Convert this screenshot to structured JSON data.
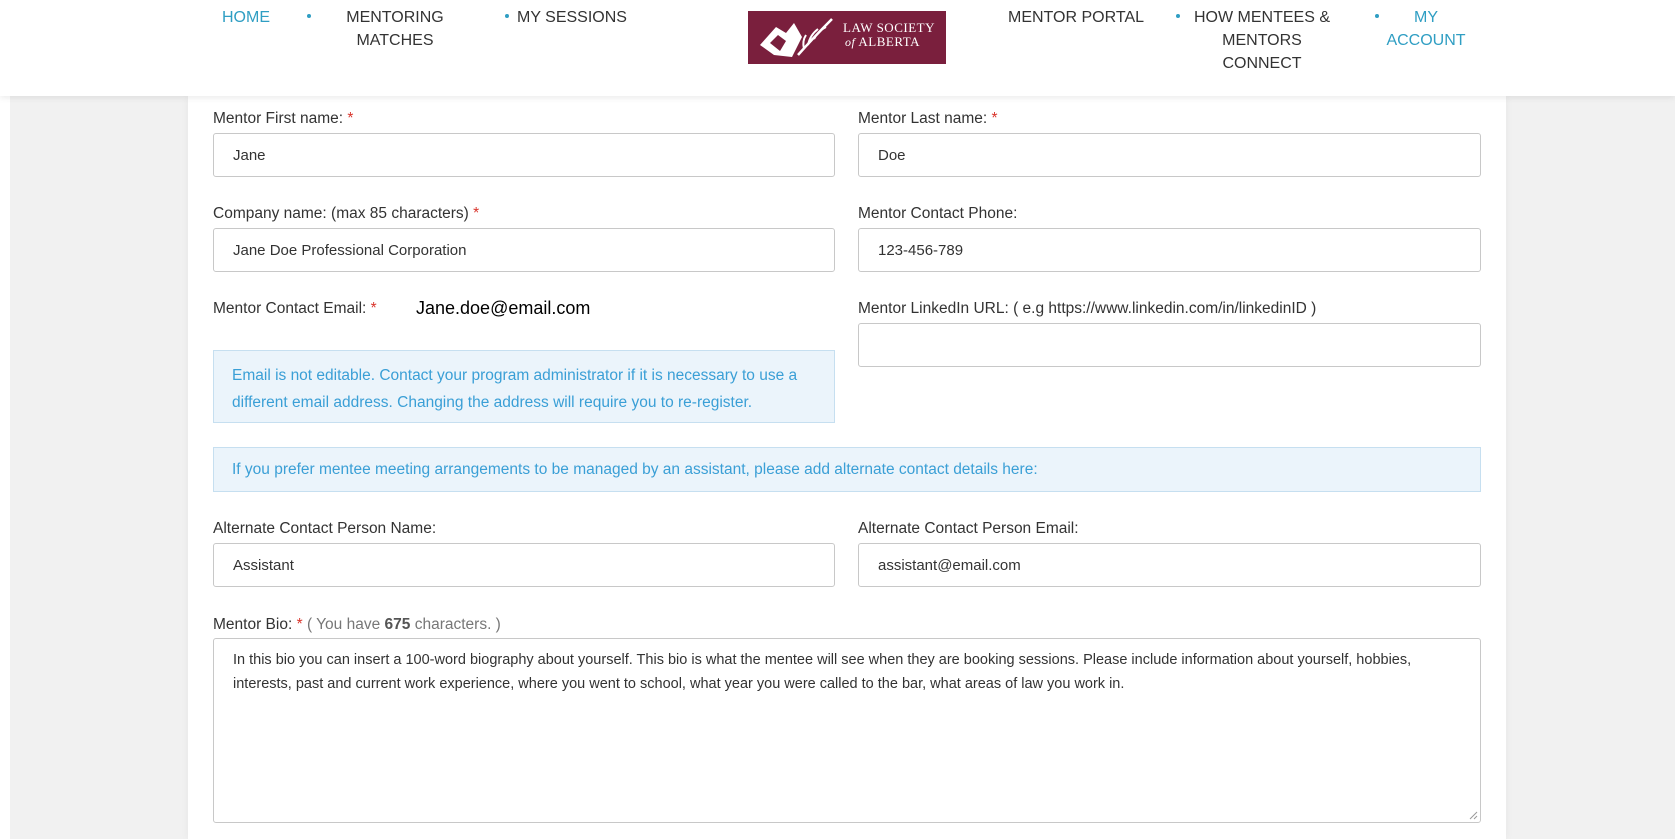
{
  "nav": {
    "home": "HOME",
    "mentoring_matches": "MENTORING MATCHES",
    "my_sessions": "MY SESSIONS",
    "mentor_portal": "MENTOR PORTAL",
    "how_connect": "HOW MENTEES & MENTORS CONNECT",
    "my_account": "MY ACCOUNT"
  },
  "logo": {
    "line1": "LAW SOCIETY",
    "line2_of": "of",
    "line2_name": "ALBERTA"
  },
  "form": {
    "first_name": {
      "label": "Mentor First name:",
      "required": "*",
      "value": "Jane"
    },
    "last_name": {
      "label": "Mentor Last name:",
      "required": "*",
      "value": "Doe"
    },
    "company": {
      "label": "Company name: (max 85 characters)",
      "required": "*",
      "value": "Jane Doe Professional Corporation"
    },
    "phone": {
      "label": "Mentor Contact Phone:",
      "value": "123-456-789"
    },
    "email": {
      "label": "Mentor Contact Email:",
      "required": "*",
      "value": "Jane.doe@email.com"
    },
    "linkedin": {
      "label": "Mentor LinkedIn URL: ( e.g https://www.linkedin.com/in/linkedinID )",
      "value": ""
    },
    "email_note": "Email is not editable. Contact your program administrator if it is necessary to use a different email address. Changing the address will require you to re-register.",
    "assistant_note": "If you prefer mentee meeting arrangements to be managed by an assistant, please add alternate contact details here:",
    "alt_name": {
      "label": "Alternate Contact Person Name:",
      "value": "Assistant"
    },
    "alt_email": {
      "label": "Alternate Contact Person Email:",
      "value": "assistant@email.com"
    },
    "bio": {
      "label": "Mentor Bio:",
      "required": "*",
      "counter_prefix": "( You have",
      "counter_value": "675",
      "counter_suffix": "characters. )",
      "value": "In this bio you can insert a 100-word biography about yourself.  This bio is what the mentee will see when they are booking sessions. Please include information about yourself, hobbies, interests, past and current work experience, where you went to school, what year you were called to the bar, what areas of law you work in."
    }
  },
  "colors": {
    "accent": "#2f9ec3",
    "logo_bg": "#7a1f3d",
    "required": "#d9342b",
    "info_text": "#3a9fd6"
  }
}
